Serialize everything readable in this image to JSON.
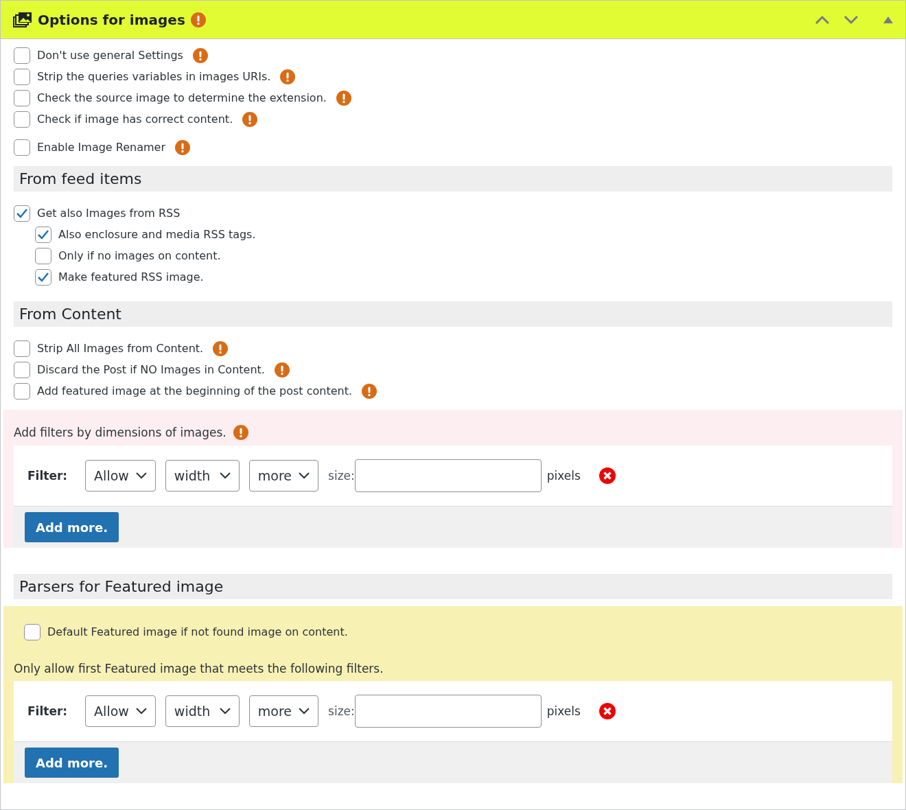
{
  "panel": {
    "title": "Options for images",
    "warning": true
  },
  "general_options": [
    {
      "label": "Don't use general Settings",
      "checked": false,
      "warning": true
    },
    {
      "label": "Strip the queries variables in images URIs.",
      "checked": false,
      "warning": true
    },
    {
      "label": "Check the source image to determine the extension.",
      "checked": false,
      "warning": true
    },
    {
      "label": "Check if image has correct content.",
      "checked": false,
      "warning": true
    },
    {
      "label": "Enable Image Renamer",
      "checked": false,
      "warning": true
    }
  ],
  "feed_section": {
    "heading": "From feed items",
    "options": [
      {
        "label": "Get also Images from RSS",
        "checked": true,
        "warning": false,
        "children": [
          {
            "label": "Also enclosure and media RSS tags.",
            "checked": true,
            "warning": false
          },
          {
            "label": "Only if no images on content.",
            "checked": false,
            "warning": false
          },
          {
            "label": "Make featured RSS image.",
            "checked": true,
            "warning": false
          }
        ]
      }
    ]
  },
  "content_section": {
    "heading": "From Content",
    "options": [
      {
        "label": "Strip All Images from Content.",
        "checked": false,
        "warning": true
      },
      {
        "label": "Discard the Post if NO Images in Content.",
        "checked": false,
        "warning": true
      },
      {
        "label": "Add featured image at the beginning of the post content.",
        "checked": false,
        "warning": true
      }
    ]
  },
  "dimension_filters": {
    "label": "Add filters by dimensions of images.",
    "warning": true,
    "filters": [
      {
        "label": "Filter:",
        "action": "Allow",
        "dimension": "width",
        "comparison": "more",
        "size_label": "size:",
        "unit": "pixels"
      }
    ],
    "add_button": "Add more."
  },
  "featured_section": {
    "heading": "Parsers for Featured image",
    "default_option": {
      "label": "Default Featured image if not found image on content.",
      "checked": false,
      "warning": false
    },
    "filters_label": "Only allow first Featured image that meets the following filters.",
    "filters": [
      {
        "label": "Filter:",
        "action": "Allow",
        "dimension": "width",
        "comparison": "more",
        "size_label": "size:",
        "unit": "pixels"
      }
    ],
    "add_button": "Add more."
  }
}
